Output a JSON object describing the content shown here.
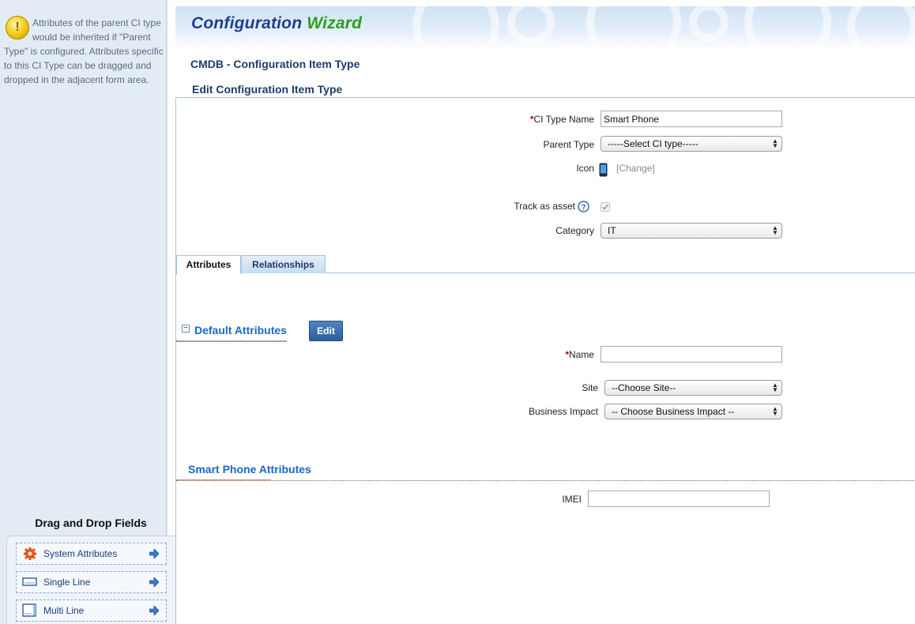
{
  "sidebar": {
    "help_text": "Attributes of the parent CI type would be inherited if \"Parent Type\" is configured. Attributes specific to this CI Type can be dragged and dropped in the adjacent form area.",
    "help_icon": "warning-icon",
    "dnd_title": "Drag and Drop Fields",
    "dnd_items": [
      {
        "label": "System Attributes",
        "icon": "gear-icon"
      },
      {
        "label": "Single Line",
        "icon": "single-line-icon"
      },
      {
        "label": "Multi Line",
        "icon": "multi-line-icon"
      }
    ]
  },
  "header": {
    "wizard_title_part1": "Configuration",
    "wizard_title_part2": "Wizard",
    "module_title": "CMDB - Configuration Item Type",
    "section_title": "Edit Configuration Item Type"
  },
  "form": {
    "ci_type_name_label": "CI Type Name",
    "ci_type_name_value": "Smart Phone",
    "parent_type_label": "Parent Type",
    "parent_type_value": "-----Select CI type-----",
    "icon_label": "Icon",
    "icon_change_link": "[Change]",
    "track_asset_label": "Track as asset",
    "track_asset_checked": true,
    "category_label": "Category",
    "category_value": "IT"
  },
  "tabs": [
    {
      "label": "Attributes",
      "active": true
    },
    {
      "label": "Relationships",
      "active": false
    }
  ],
  "default_attributes": {
    "title": "Default Attributes",
    "edit_label": "Edit",
    "name_label": "Name",
    "name_value": "",
    "site_label": "Site",
    "site_value": "--Choose Site--",
    "business_impact_label": "Business Impact",
    "business_impact_value": "-- Choose Business Impact --"
  },
  "smart_phone_attributes": {
    "title": "Smart Phone Attributes",
    "imei_label": "IMEI",
    "imei_value": ""
  },
  "colors": {
    "wizard_blue": "#1d3f8f",
    "wizard_green": "#2b9e1f",
    "required": "#c00000",
    "group_heading": "#1a66c9"
  }
}
